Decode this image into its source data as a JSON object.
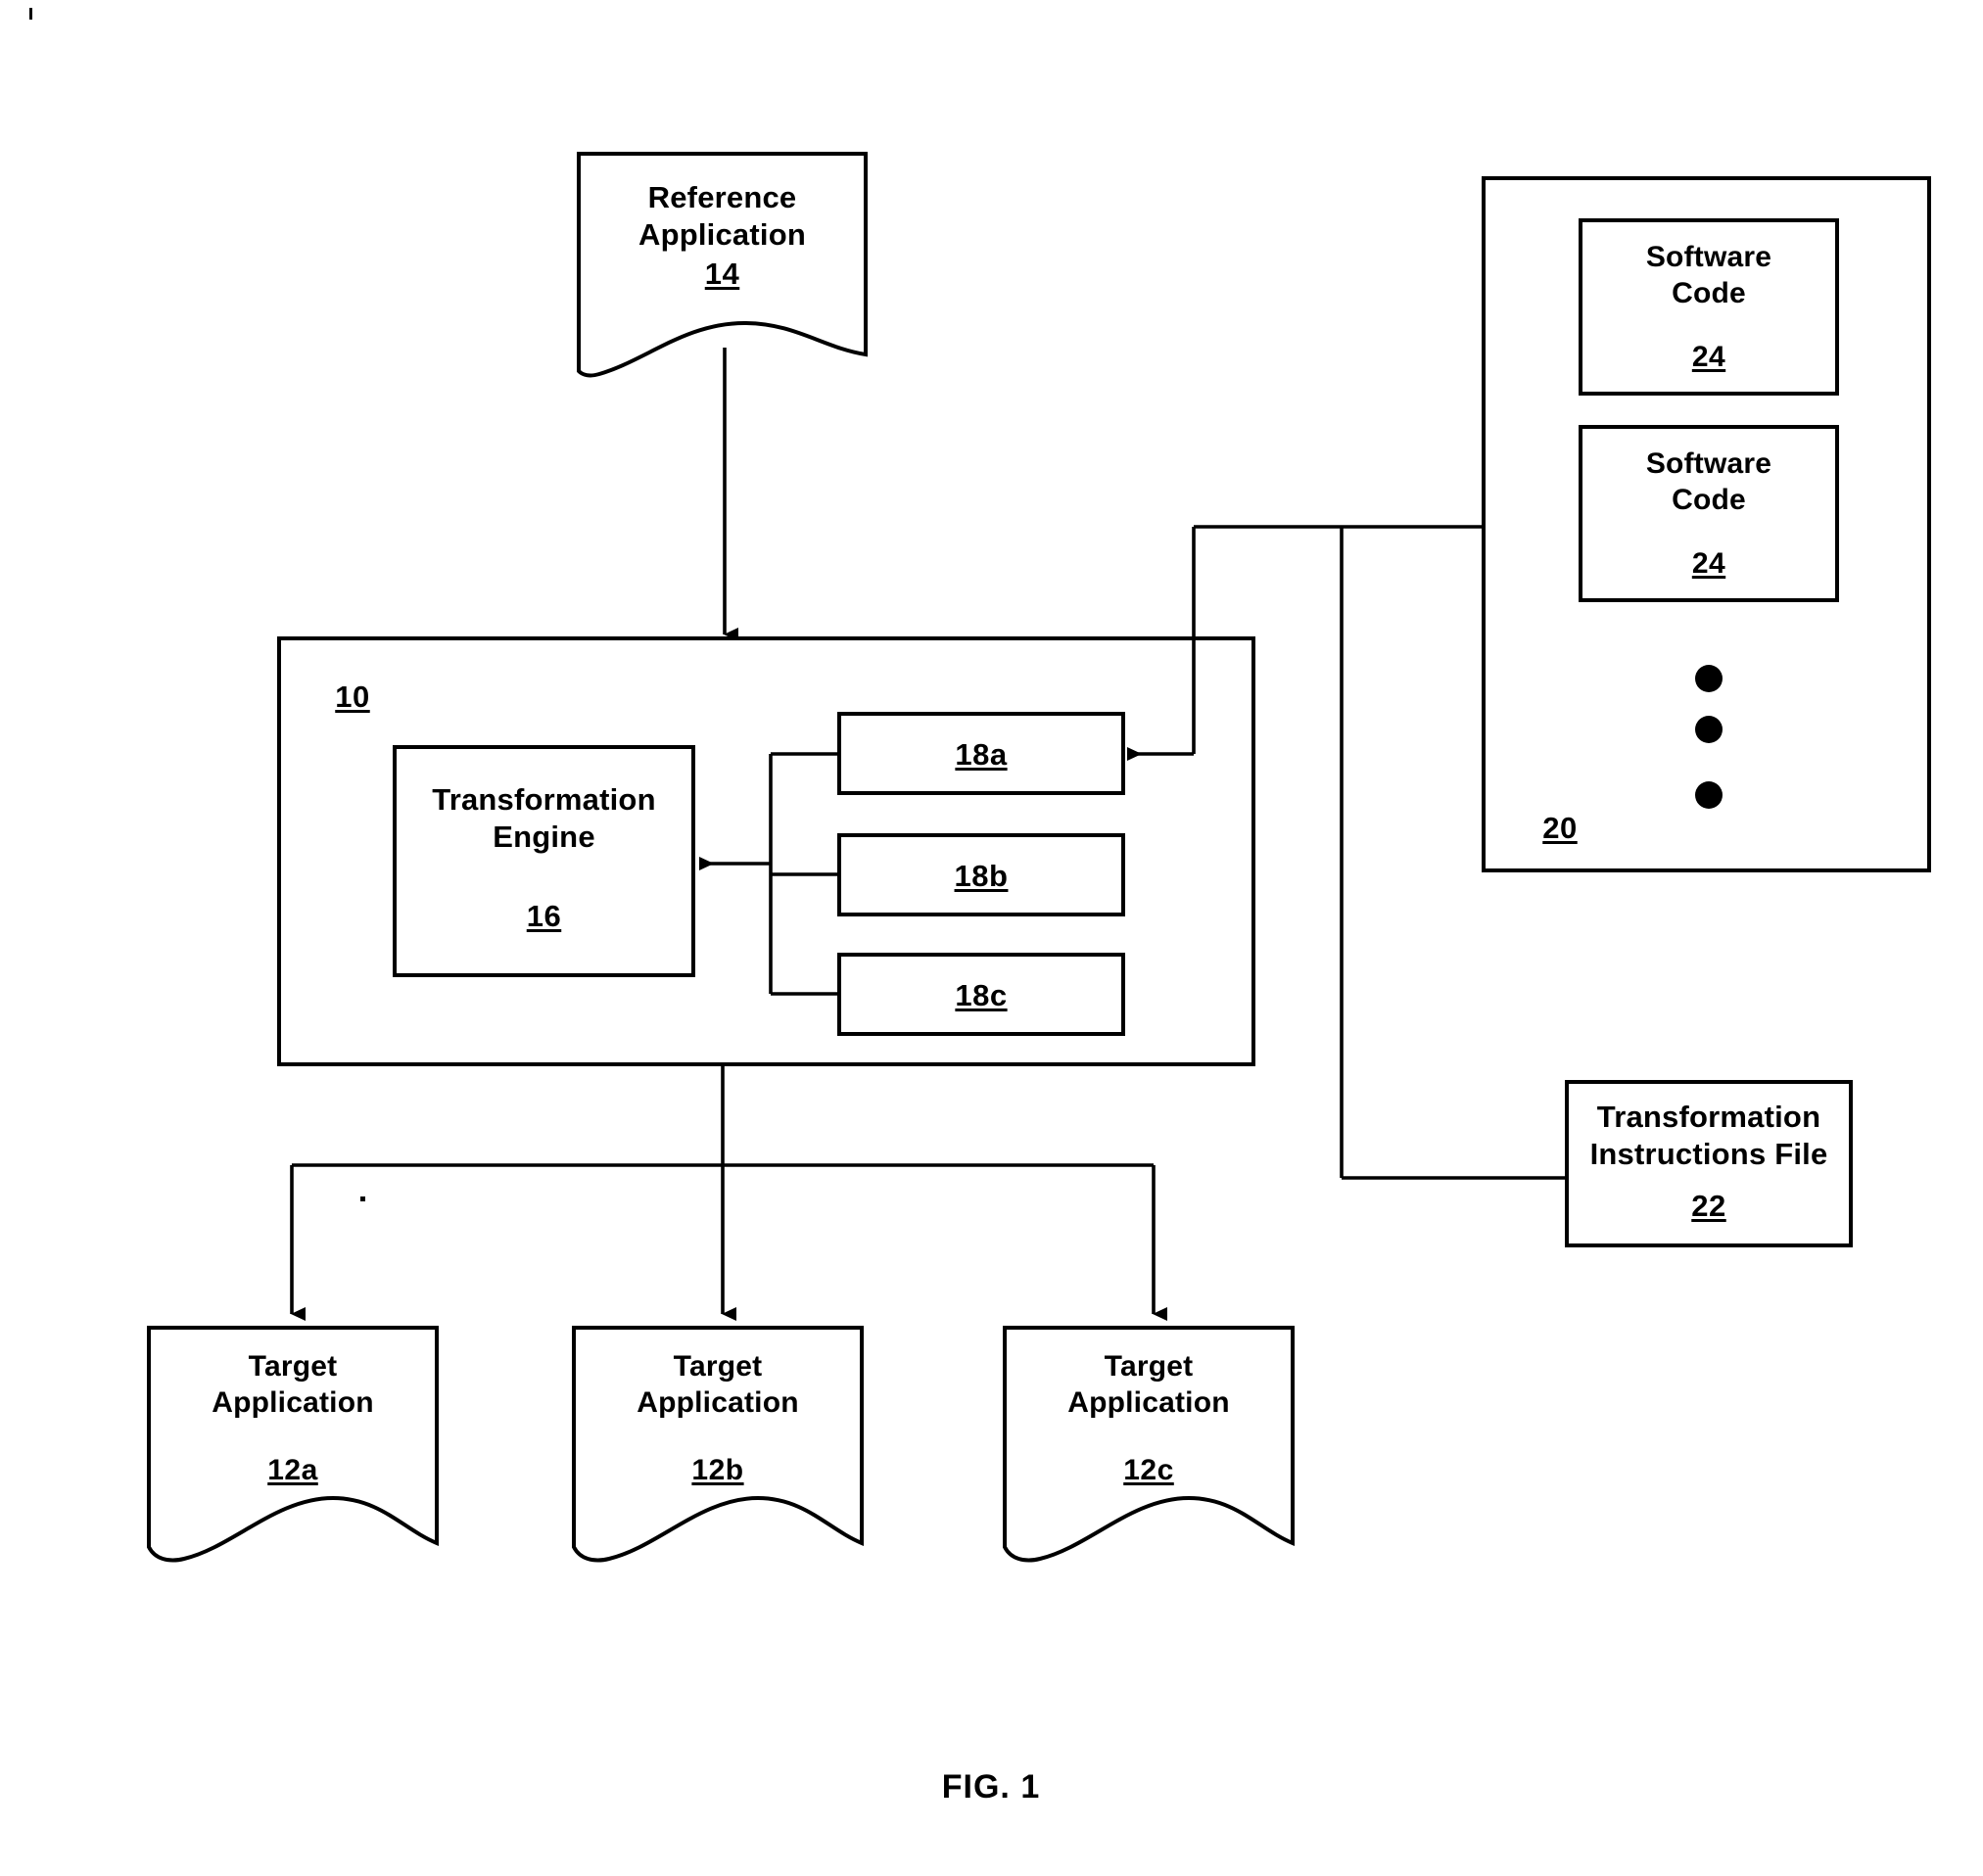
{
  "figure": {
    "caption": "FIG. 1",
    "type": "patent-block-diagram"
  },
  "nodes": {
    "reference_application": {
      "label_line1": "Reference",
      "label_line2": "Application",
      "ref": "14",
      "shape": "torn-document"
    },
    "system": {
      "ref": "10",
      "shape": "rectangle"
    },
    "transformation_engine": {
      "label_line1": "Transformation",
      "label_line2": "Engine",
      "ref": "16",
      "shape": "rectangle"
    },
    "modules": [
      {
        "ref": "18a",
        "shape": "rectangle"
      },
      {
        "ref": "18b",
        "shape": "rectangle"
      },
      {
        "ref": "18c",
        "shape": "rectangle"
      }
    ],
    "code_repository": {
      "ref": "20",
      "shape": "rectangle",
      "items": [
        {
          "label_line1": "Software",
          "label_line2": "Code",
          "ref": "24"
        },
        {
          "label_line1": "Software",
          "label_line2": "Code",
          "ref": "24"
        }
      ],
      "ellipsis": "vertical-three-dots"
    },
    "transformation_instructions_file": {
      "label_line1": "Transformation",
      "label_line2": "Instructions File",
      "ref": "22",
      "shape": "rectangle"
    },
    "target_applications": [
      {
        "label_line1": "Target",
        "label_line2": "Application",
        "ref": "12a",
        "shape": "torn-document"
      },
      {
        "label_line1": "Target",
        "label_line2": "Application",
        "ref": "12b",
        "shape": "torn-document"
      },
      {
        "label_line1": "Target",
        "label_line2": "Application",
        "ref": "12c",
        "shape": "torn-document"
      }
    ]
  },
  "connections": [
    {
      "from": "reference_application",
      "to": "system",
      "style": "arrow-down"
    },
    {
      "from": "code_repository",
      "to": "module_18a",
      "style": "arrow-left"
    },
    {
      "from": "modules_bracket",
      "to": "transformation_engine",
      "style": "arrow-left"
    },
    {
      "from": "transformation_instructions_file",
      "to": "module_18a",
      "style": "line"
    },
    {
      "from": "system",
      "to": "target_application_12a",
      "style": "arrow-down"
    },
    {
      "from": "system",
      "to": "target_application_12b",
      "style": "arrow-down"
    },
    {
      "from": "system",
      "to": "target_application_12c",
      "style": "arrow-down"
    }
  ],
  "colors": {
    "stroke": "#000000",
    "background": "#ffffff",
    "text": "#000000"
  }
}
